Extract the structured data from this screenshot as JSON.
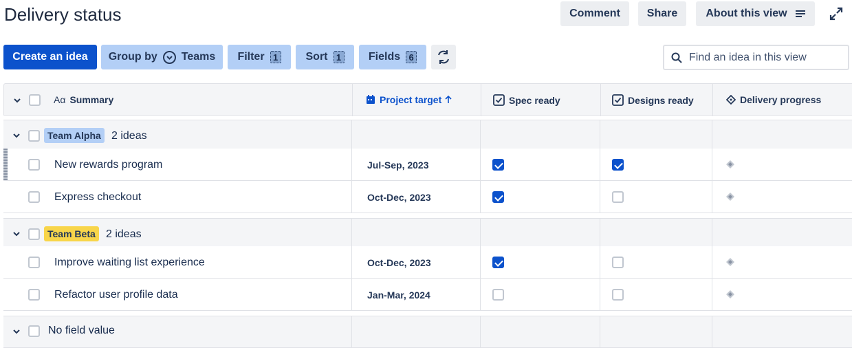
{
  "header": {
    "title": "Delivery status",
    "comment_label": "Comment",
    "share_label": "Share",
    "about_label": "About this view",
    "expand_icon": "expand-icon"
  },
  "toolbar": {
    "create_label": "Create an idea",
    "group_by_label": "Group by",
    "group_by_value": "Teams",
    "filter_label": "Filter",
    "filter_count": "1",
    "sort_label": "Sort",
    "sort_count": "1",
    "fields_label": "Fields",
    "fields_count": "6",
    "search_placeholder": "Find an idea in this view"
  },
  "columns": {
    "summary": "Summary",
    "summary_icon": "Aα",
    "project_target": "Project target",
    "spec_ready": "Spec ready",
    "designs_ready": "Designs ready",
    "delivery_progress": "Delivery progress"
  },
  "groups": [
    {
      "name": "Team Alpha",
      "count_label": "2 ideas",
      "tag_color": "#b3cff6",
      "rows": [
        {
          "summary": "New rewards program",
          "target": "Jul-Sep, 2023",
          "spec_ready": true,
          "designs_ready": true
        },
        {
          "summary": "Express checkout",
          "target": "Oct-Dec, 2023",
          "spec_ready": true,
          "designs_ready": false
        }
      ]
    },
    {
      "name": "Team Beta",
      "count_label": "2 ideas",
      "tag_color": "#f8d54a",
      "rows": [
        {
          "summary": "Improve waiting list experience",
          "target": "Oct-Dec, 2023",
          "spec_ready": true,
          "designs_ready": false
        },
        {
          "summary": "Refactor user profile data",
          "target": "Jan-Mar, 2024",
          "spec_ready": false,
          "designs_ready": false
        }
      ]
    },
    {
      "name": "No field value",
      "count_label": "",
      "rows": []
    }
  ],
  "colors": {
    "primary": "#0c52cc",
    "secondary": "#b3cff6",
    "link_blue": "#0c52cc"
  }
}
